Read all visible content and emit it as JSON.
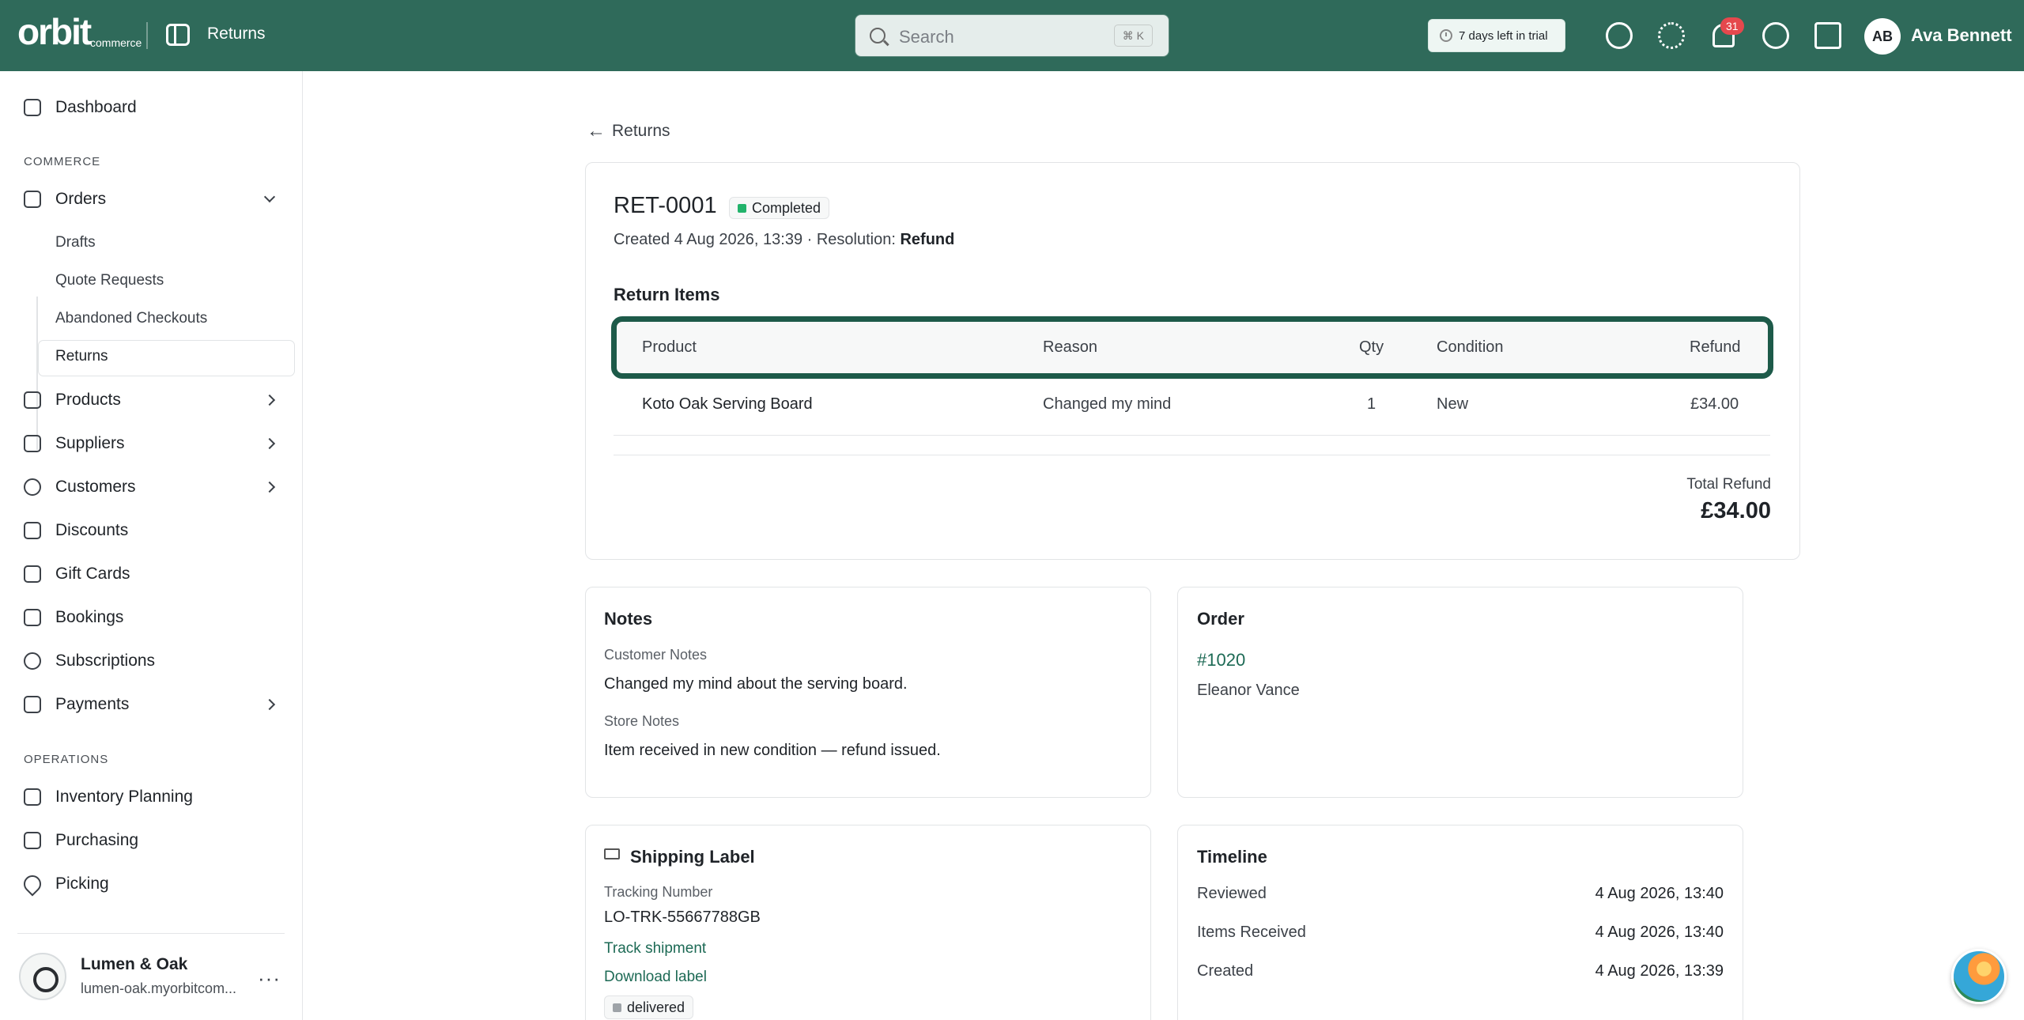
{
  "topbar": {
    "logo_word": "orbit",
    "logo_sub": "commerce",
    "page_title": "Returns",
    "search_placeholder": "Search",
    "search_shortcut": "⌘ K",
    "trial_text": "7 days left in trial",
    "notifications_count": "31",
    "user_initials": "AB",
    "user_name": "Ava Bennett"
  },
  "sidebar": {
    "dashboard": "Dashboard",
    "commerce_label": "COMMERCE",
    "orders": "Orders",
    "orders_sub": [
      "Drafts",
      "Quote Requests",
      "Abandoned Checkouts",
      "Returns"
    ],
    "products": "Products",
    "suppliers": "Suppliers",
    "customers": "Customers",
    "discounts": "Discounts",
    "gift_cards": "Gift Cards",
    "bookings": "Bookings",
    "subscriptions": "Subscriptions",
    "payments": "Payments",
    "operations_label": "OPERATIONS",
    "inventory_planning": "Inventory Planning",
    "purchasing": "Purchasing",
    "picking": "Picking",
    "store_name": "Lumen & Oak",
    "store_url": "lumen-oak.myorbitcom..."
  },
  "main": {
    "back_label": "Returns",
    "return_id": "RET-0001",
    "status": "Completed",
    "created_text": "Created 4 Aug 2026, 13:39 · Resolution: ",
    "resolution": "Refund",
    "items_title": "Return Items",
    "columns": {
      "product": "Product",
      "reason": "Reason",
      "qty": "Qty",
      "condition": "Condition",
      "refund": "Refund"
    },
    "items": [
      {
        "product": "Koto Oak Serving Board",
        "reason": "Changed my mind",
        "qty": "1",
        "condition": "New",
        "refund": "£34.00"
      }
    ],
    "total_label": "Total Refund",
    "total_value": "£34.00"
  },
  "notes": {
    "title": "Notes",
    "customer_label": "Customer Notes",
    "customer_text": "Changed my mind about the serving board.",
    "store_label": "Store Notes",
    "store_text": "Item received in new condition — refund issued."
  },
  "order": {
    "title": "Order",
    "number": "#1020",
    "customer": "Eleanor Vance"
  },
  "shipping": {
    "title": "Shipping Label",
    "tracking_label": "Tracking Number",
    "tracking_number": "LO-TRK-55667788GB",
    "track_link": "Track shipment",
    "download_link": "Download label",
    "status": "delivered"
  },
  "timeline": {
    "title": "Timeline",
    "events": [
      {
        "label": "Reviewed",
        "date": "4 Aug 2026, 13:40"
      },
      {
        "label": "Items Received",
        "date": "4 Aug 2026, 13:40"
      },
      {
        "label": "Created",
        "date": "4 Aug 2026, 13:39"
      }
    ]
  }
}
